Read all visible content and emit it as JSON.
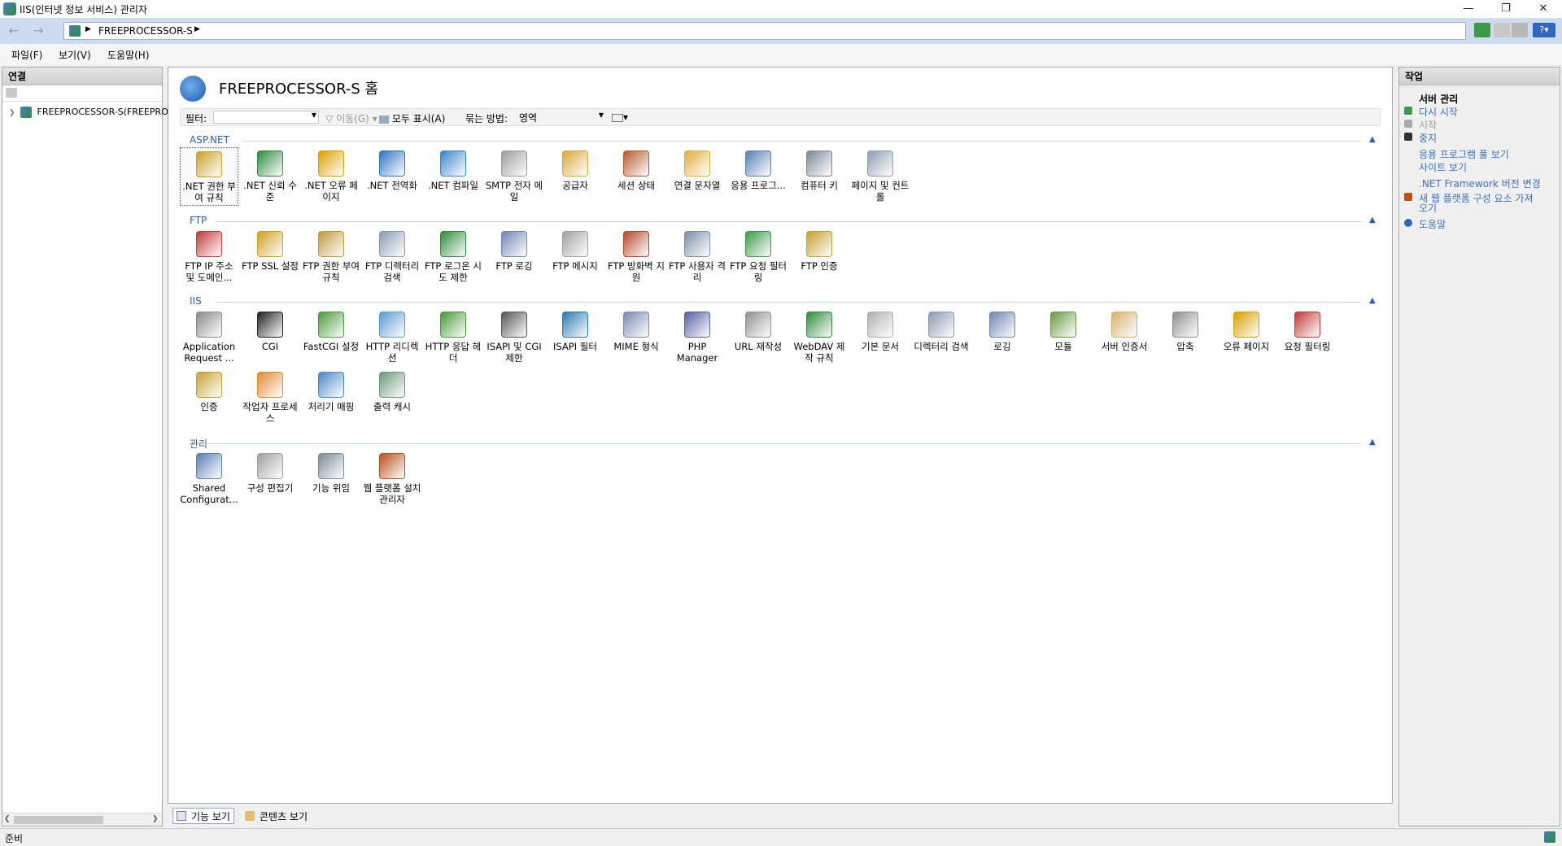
{
  "window": {
    "title": "IIS(인터넷 정보 서비스) 관리자"
  },
  "address": {
    "crumb": "FREEPROCESSOR-S"
  },
  "menu": [
    {
      "label": "파일(F)"
    },
    {
      "label": "보기(V)"
    },
    {
      "label": "도움말(H)"
    }
  ],
  "connections": {
    "title": "연결",
    "tree_item": "FREEPROCESSOR-S(FREEPRO"
  },
  "main": {
    "title": "FREEPROCESSOR-S 홈",
    "filter": {
      "label": "필터:",
      "go": "이동(G)",
      "show_all": "모두 표시(A)",
      "group_by": "묶는 방법:",
      "group_value": "영역"
    },
    "groups": [
      {
        "name": "ASP.NET",
        "items": [
          {
            "label": ".NET 권한 부여 규칙",
            "icon": "lock-users-icon",
            "color": "#c9a227"
          },
          {
            "label": ".NET 신뢰 수준",
            "icon": "globe-check-icon",
            "color": "#2e8b3d"
          },
          {
            "label": ".NET 오류 페이지",
            "icon": "error-404-icon",
            "color": "#d9a000"
          },
          {
            "label": ".NET 전역화",
            "icon": "globe-icon",
            "color": "#2f74c0"
          },
          {
            "label": ".NET 컴파일",
            "icon": "download-stack-icon",
            "color": "#3a87c9"
          },
          {
            "label": "SMTP 전자 메일",
            "icon": "mail-icon",
            "color": "#9b9b9b"
          },
          {
            "label": "공급자",
            "icon": "users-icon",
            "color": "#d8a93a"
          },
          {
            "label": "세션 상태",
            "icon": "user-arrow-icon",
            "color": "#b45c2a"
          },
          {
            "label": "연결 문자열",
            "icon": "database-icon",
            "color": "#e0b03a"
          },
          {
            "label": "응용 프로그...",
            "icon": "list-icon",
            "color": "#5a7fb5"
          },
          {
            "label": "컴퓨터 키",
            "icon": "server-key-icon",
            "color": "#7a8a99"
          },
          {
            "label": "페이지 및 컨트롤",
            "icon": "page-grid-icon",
            "color": "#8e9db0"
          }
        ]
      },
      {
        "name": "FTP",
        "items": [
          {
            "label": "FTP IP 주소 및 도메인...",
            "icon": "ftp-ip-icon",
            "color": "#c23a3a"
          },
          {
            "label": "FTP SSL 설정",
            "icon": "ftp-lock-icon",
            "color": "#d0a020"
          },
          {
            "label": "FTP 권한 부여 규칙",
            "icon": "ftp-auth-icon",
            "color": "#c29a3c"
          },
          {
            "label": "FTP 디렉터리 검색",
            "icon": "ftp-folder-icon",
            "color": "#8a9bb0"
          },
          {
            "label": "FTP 로그온 시도 제한",
            "icon": "ftp-globe-icon",
            "color": "#2e8b3d"
          },
          {
            "label": "FTP 로깅",
            "icon": "ftp-log-icon",
            "color": "#6f86b3"
          },
          {
            "label": "FTP 메시지",
            "icon": "ftp-message-icon",
            "color": "#a0a0a0"
          },
          {
            "label": "FTP 방화벽 지원",
            "icon": "ftp-firewall-icon",
            "color": "#b24a2a"
          },
          {
            "label": "FTP 사용자 격리",
            "icon": "ftp-users-icon",
            "color": "#7c8fa8"
          },
          {
            "label": "FTP 요청 필터링",
            "icon": "ftp-filter-icon",
            "color": "#3a9a4a"
          },
          {
            "label": "FTP 인증",
            "icon": "ftp-key-icon",
            "color": "#c8a030"
          }
        ]
      },
      {
        "name": "IIS",
        "items": [
          {
            "label": "Application Request ...",
            "icon": "arr-server-icon",
            "color": "#8a8a8a"
          },
          {
            "label": "CGI",
            "icon": "cgi-icon",
            "color": "#222222"
          },
          {
            "label": "FastCGI 설정",
            "icon": "fastcgi-icon",
            "color": "#4a9a3a"
          },
          {
            "label": "HTTP 리디렉션",
            "icon": "redirect-icon",
            "color": "#5a9ad0"
          },
          {
            "label": "HTTP 응답 헤더",
            "icon": "response-header-icon",
            "color": "#4a9a3a"
          },
          {
            "label": "ISAPI 및 CGI 제한",
            "icon": "isapi-cgi-icon",
            "color": "#555555"
          },
          {
            "label": "ISAPI 필터",
            "icon": "isapi-filter-icon",
            "color": "#2a7ab0"
          },
          {
            "label": "MIME 형식",
            "icon": "mime-icon",
            "color": "#7a8ab0"
          },
          {
            "label": "PHP Manager",
            "icon": "php-icon",
            "color": "#5560a0"
          },
          {
            "label": "URL 재작성",
            "icon": "url-rewrite-icon",
            "color": "#909090"
          },
          {
            "label": "WebDAV 제작 규칙",
            "icon": "webdav-icon",
            "color": "#2e8b3d"
          },
          {
            "label": "기본 문서",
            "icon": "default-doc-icon",
            "color": "#b0b0b0"
          },
          {
            "label": "디렉터리 검색",
            "icon": "dir-browse-icon",
            "color": "#8a9bb0"
          },
          {
            "label": "로깅",
            "icon": "logging-icon",
            "color": "#6f86b3"
          },
          {
            "label": "모듈",
            "icon": "modules-icon",
            "color": "#6a9a40"
          },
          {
            "label": "서버 인증서",
            "icon": "certificate-icon",
            "color": "#d8b070"
          },
          {
            "label": "압축",
            "icon": "compression-icon",
            "color": "#909090"
          },
          {
            "label": "오류 페이지",
            "icon": "error-page-icon",
            "color": "#d9a000"
          },
          {
            "label": "요청 필터링",
            "icon": "request-filter-icon",
            "color": "#c03a3a"
          },
          {
            "label": "인증",
            "icon": "authentication-icon",
            "color": "#c8a030"
          },
          {
            "label": "작업자 프로세스",
            "icon": "worker-process-icon",
            "color": "#e08a30"
          },
          {
            "label": "처리기 매핑",
            "icon": "handler-mapping-icon",
            "color": "#4a88c8"
          },
          {
            "label": "출력 캐시",
            "icon": "output-cache-icon",
            "color": "#6a9a7a"
          }
        ]
      },
      {
        "name": "관리",
        "items": [
          {
            "label": "Shared Configurat...",
            "icon": "shared-config-icon",
            "color": "#5a7fb5"
          },
          {
            "label": "구성 편집기",
            "icon": "config-editor-icon",
            "color": "#a0a0a0"
          },
          {
            "label": "기능 위임",
            "icon": "feature-delegation-icon",
            "color": "#7a8a99"
          },
          {
            "label": "웹 플랫폼 설치 관리자",
            "icon": "web-platform-icon",
            "color": "#b8501a"
          }
        ]
      }
    ]
  },
  "bottom_tabs": {
    "features": "기능 보기",
    "content": "콘텐츠 보기"
  },
  "actions": {
    "title": "작업",
    "items": [
      {
        "label": "서버 관리",
        "type": "header"
      },
      {
        "label": "다시 시작",
        "type": "link",
        "icon": "restart-icon"
      },
      {
        "label": "시작",
        "type": "disabled",
        "icon": "start-icon"
      },
      {
        "label": "중지",
        "type": "link",
        "icon": "stop-icon"
      },
      {
        "label": "응용 프로그램 풀 보기",
        "type": "link"
      },
      {
        "label": "사이트 보기",
        "type": "link"
      },
      {
        "label": ".NET Framework 버전 변경",
        "type": "link"
      },
      {
        "label": "새 웹 플랫폼 구성 요소 가져",
        "type": "link",
        "icon": "web-platform-icon"
      },
      {
        "label": "오기",
        "type": "link"
      },
      {
        "label": "도움말",
        "type": "link",
        "icon": "help-icon"
      }
    ]
  },
  "status": {
    "text": "준비"
  }
}
